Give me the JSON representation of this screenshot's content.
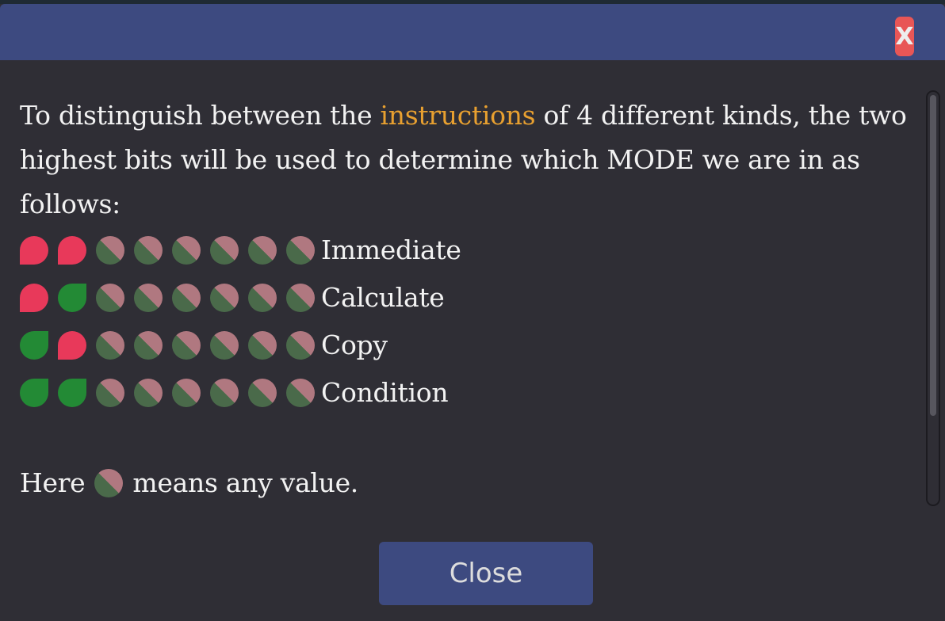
{
  "dialog": {
    "close_icon": "X",
    "text_before": "To distinguish between the ",
    "highlight": "instructions",
    "text_after": " of 4 different kinds, the two highest bits will be used to determine which MODE we are in as follows:",
    "modes": [
      {
        "label": "Immediate",
        "bits": [
          1,
          1,
          "x",
          "x",
          "x",
          "x",
          "x",
          "x"
        ]
      },
      {
        "label": "Calculate",
        "bits": [
          1,
          0,
          "x",
          "x",
          "x",
          "x",
          "x",
          "x"
        ]
      },
      {
        "label": "Copy",
        "bits": [
          0,
          1,
          "x",
          "x",
          "x",
          "x",
          "x",
          "x"
        ]
      },
      {
        "label": "Condition",
        "bits": [
          0,
          0,
          "x",
          "x",
          "x",
          "x",
          "x",
          "x"
        ]
      }
    ],
    "note_before": "Here",
    "note_after": "means any value.",
    "close_label": "Close"
  },
  "colors": {
    "titlebar": "#3d4a80",
    "highlight": "#e8a030",
    "bit_on": "#e8395a",
    "bit_off": "#238a35"
  }
}
